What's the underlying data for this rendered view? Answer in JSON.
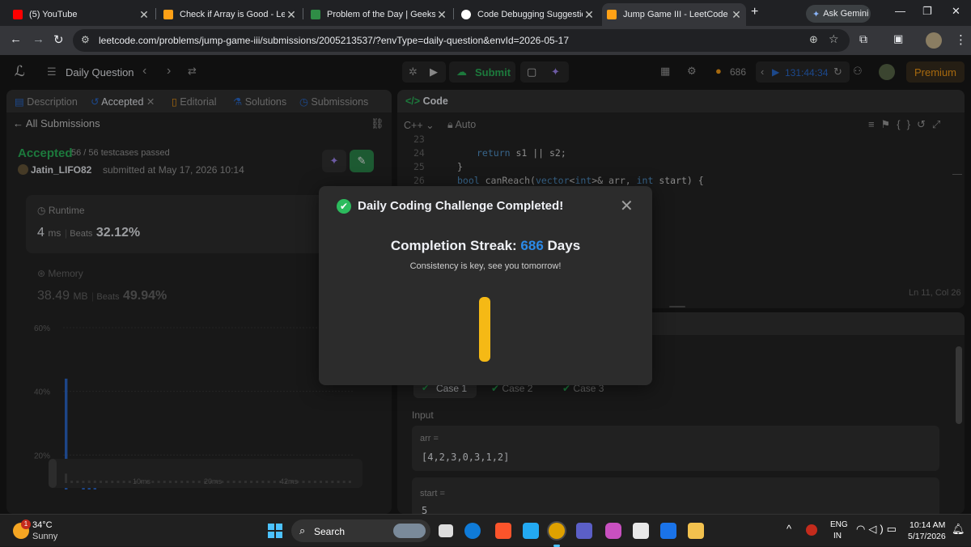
{
  "browser": {
    "tabs": [
      {
        "title": "(5) YouTube",
        "color": "#ff0000"
      },
      {
        "title": "Check if Array is Good - LeetCo",
        "color": "#ffa116"
      },
      {
        "title": "Problem of the Day | GeeksforG",
        "color": "#2f8d46"
      },
      {
        "title": "Code Debugging Suggestions",
        "color": "#ffffff"
      },
      {
        "title": "Jump Game III - LeetCode",
        "color": "#ffa116"
      }
    ],
    "ask_gemini": "Ask Gemini",
    "url": "leetcode.com/problems/jump-game-iii/submissions/2005213537/?envType=daily-question&envId=2026-05-17"
  },
  "header": {
    "daily_question": "Daily Question",
    "submit": "Submit",
    "streak": "686",
    "timer": "131:44:34",
    "premium": "Premium"
  },
  "left_tabs": {
    "description": "Description",
    "accepted": "Accepted",
    "editorial": "Editorial",
    "solutions": "Solutions",
    "submissions": "Submissions"
  },
  "submission": {
    "back": "All Submissions",
    "status": "Accepted",
    "testcases": "56 / 56 testcases passed",
    "user": "Jatin_LIFO82",
    "submitted": "submitted at May 17, 2026 10:14",
    "runtime_label": "Runtime",
    "runtime_value": "4",
    "runtime_unit": "ms",
    "beats_label": "Beats",
    "runtime_beats": "32.12%",
    "memory_label": "Memory",
    "memory_value": "38.49",
    "memory_unit": "MB",
    "memory_beats": "49.94%"
  },
  "chart_data": {
    "type": "bar",
    "y_ticks": [
      "60%",
      "40%",
      "20%",
      "0%"
    ],
    "x_ticks": [
      "10ms",
      "20ms",
      "42ms"
    ],
    "ylim": [
      0,
      60
    ],
    "values": [
      44,
      4,
      4,
      10,
      12,
      12,
      1.5,
      1,
      1,
      1,
      1,
      1,
      1,
      1.5,
      1,
      1,
      1.5,
      1,
      1,
      1,
      1,
      1,
      1,
      1,
      1,
      1,
      1,
      1,
      1,
      1,
      1,
      1,
      1,
      1,
      1,
      1,
      1,
      1,
      1,
      1,
      1,
      1,
      1,
      1,
      1,
      1,
      1,
      1,
      1,
      1
    ],
    "highlight_index": 4,
    "bar_color": "#2d6bcf"
  },
  "code": {
    "title": "Code",
    "language": "C++",
    "mode": "Auto",
    "lines": [
      {
        "n": "23",
        "text": ""
      },
      {
        "n": "24",
        "text": "return s1 || s2;"
      },
      {
        "n": "25",
        "text": "}"
      },
      {
        "n": "26",
        "text": "bool canReach(vector<int>& arr, int start) {"
      }
    ],
    "cursor": "Ln 11, Col 26"
  },
  "testcases": {
    "cases": [
      "Case 1",
      "Case 2",
      "Case 3"
    ],
    "input_label": "Input",
    "arr_label": "arr =",
    "arr_value": "[4,2,3,0,3,1,2]",
    "start_label": "start =",
    "start_value": "5"
  },
  "modal": {
    "title": "Daily Coding Challenge Completed!",
    "streak_label": "Completion Streak:",
    "streak_value": "686",
    "streak_unit": "Days",
    "message": "Consistency is key, see you tomorrow!"
  },
  "taskbar": {
    "temp": "34°C",
    "weather": "Sunny",
    "search": "Search",
    "lang1": "ENG",
    "lang2": "IN",
    "time": "10:14 AM",
    "date": "5/17/2026",
    "notif": "1"
  }
}
